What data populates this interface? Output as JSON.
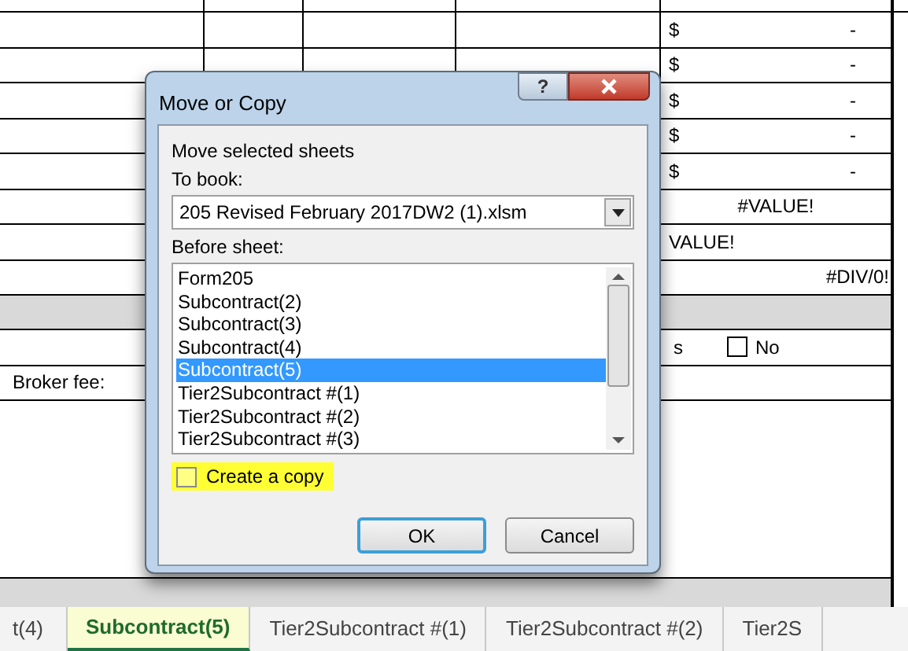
{
  "sheet": {
    "rows": [
      {
        "kind": "money",
        "col_a": "$",
        "col_b": "-"
      },
      {
        "kind": "money",
        "col_a": "$",
        "col_b": "-"
      },
      {
        "kind": "money",
        "col_a": "$",
        "col_b": "-"
      },
      {
        "kind": "money",
        "col_a": "$",
        "col_b": "-"
      },
      {
        "kind": "money",
        "col_a": "$",
        "col_b": "-"
      },
      {
        "kind": "center",
        "col_a": "#VALUE!"
      },
      {
        "kind": "left",
        "col_a": "VALUE!"
      },
      {
        "kind": "right",
        "col_a": "#DIV/0!"
      },
      {
        "kind": "band"
      },
      {
        "kind": "check",
        "col_a": "s",
        "checkbox_label": "No",
        "checked": false
      },
      {
        "kind": "label",
        "label": "Broker fee:"
      }
    ]
  },
  "dialog": {
    "title": "Move or Copy",
    "help": "?",
    "intro": "Move selected sheets",
    "to_book_label": "To book:",
    "to_book_value": "205 Revised February 2017DW2 (1).xlsm",
    "before_sheet_label": "Before sheet:",
    "sheets": [
      {
        "label": "Form205",
        "selected": false
      },
      {
        "label": "Subcontract(2)",
        "selected": false
      },
      {
        "label": "Subcontract(3)",
        "selected": false
      },
      {
        "label": "Subcontract(4)",
        "selected": false
      },
      {
        "label": "Subcontract(5)",
        "selected": true
      },
      {
        "label": "Tier2Subcontract #(1)",
        "selected": false
      },
      {
        "label": "Tier2Subcontract #(2)",
        "selected": false
      },
      {
        "label": "Tier2Subcontract #(3)",
        "selected": false
      }
    ],
    "create_copy": {
      "label": "Create a copy",
      "checked": false,
      "highlighted": true
    },
    "buttons": [
      "OK",
      "Cancel"
    ]
  },
  "sheet_tabs": [
    {
      "label": "t(4)",
      "selected": false
    },
    {
      "label": "Subcontract(5)",
      "selected": true
    },
    {
      "label": "Tier2Subcontract #(1)",
      "selected": false
    },
    {
      "label": "Tier2Subcontract #(2)",
      "selected": false
    },
    {
      "label": "Tier2S",
      "selected": false
    }
  ]
}
